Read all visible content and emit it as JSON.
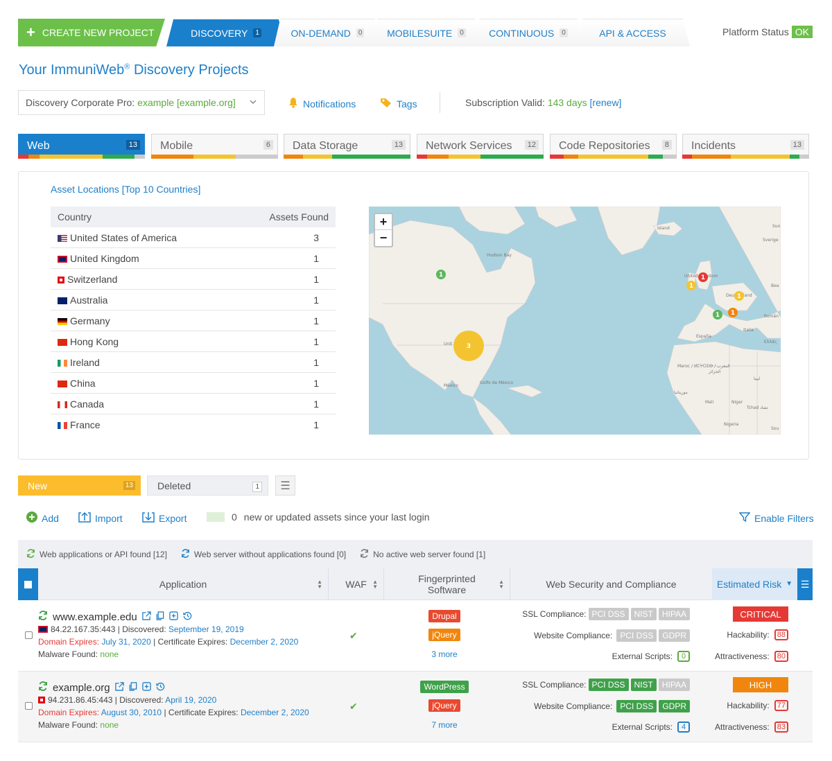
{
  "topnav": {
    "create_label": "CREATE NEW PROJECT",
    "tabs": [
      {
        "label": "DISCOVERY",
        "count": "1"
      },
      {
        "label": "ON-DEMAND",
        "count": "0"
      },
      {
        "label": "MOBILESUITE",
        "count": "0"
      },
      {
        "label": "CONTINUOUS",
        "count": "0"
      },
      {
        "label": "API & ACCESS",
        "count": ""
      }
    ],
    "platform_status_label": "Platform Status",
    "platform_status_value": "OK"
  },
  "page": {
    "title": "Your ImmuniWeb",
    "title_reg": "®",
    "title_suffix": " Discovery Projects"
  },
  "project": {
    "plan_label": "Discovery Corporate Pro:",
    "name": "example [example.org]",
    "notifications_label": "Notifications",
    "tags_label": "Tags",
    "subscription_label": "Subscription Valid:",
    "subscription_days": "143 days",
    "renew_label": "[renew]"
  },
  "asset_tabs": [
    {
      "label": "Web",
      "count": "13"
    },
    {
      "label": "Mobile",
      "count": "6"
    },
    {
      "label": "Data Storage",
      "count": "13"
    },
    {
      "label": "Network Services",
      "count": "12"
    },
    {
      "label": "Code Repositories",
      "count": "8"
    },
    {
      "label": "Incidents",
      "count": "13"
    }
  ],
  "locations": {
    "title": "Asset Locations [Top 10 Countries]",
    "col_country": "Country",
    "col_assets": "Assets Found",
    "rows": [
      {
        "country": "United States of America",
        "count": "3"
      },
      {
        "country": "United Kingdom",
        "count": "1"
      },
      {
        "country": "Switzerland",
        "count": "1"
      },
      {
        "country": "Australia",
        "count": "1"
      },
      {
        "country": "Germany",
        "count": "1"
      },
      {
        "country": "Hong Kong",
        "count": "1"
      },
      {
        "country": "Ireland",
        "count": "1"
      },
      {
        "country": "China",
        "count": "1"
      },
      {
        "country": "Canada",
        "count": "1"
      },
      {
        "country": "France",
        "count": "1"
      }
    ]
  },
  "map": {
    "zoom_in": "+",
    "zoom_out": "−",
    "labels": [
      "Ísland",
      "Sverige",
      "Hudson Bay",
      "United Kingdom",
      "Deutschland",
      "España",
      "Italia",
      "Ελλάς",
      "Român",
      "Maroc / ⵍⵎⵖⵔⵉⴱ / المغرب",
      "الجزائر",
      "ليبيا",
      "موريتانيا",
      "Mali",
      "Niger",
      "Tchad تشاد",
      "Nigeria",
      "México",
      "Golfo de México",
      "Unit",
      "Sou",
      "Bea",
      "Suo"
    ],
    "clusters": [
      {
        "label": "3",
        "color": "#f4c430"
      },
      {
        "label": "1",
        "color": "#5cb85c"
      },
      {
        "label": "1",
        "color": "#e53935"
      },
      {
        "label": "1",
        "color": "#f4c430"
      },
      {
        "label": "1",
        "color": "#f4c430"
      },
      {
        "label": "1",
        "color": "#5cb85c"
      },
      {
        "label": "1",
        "color": "#f0860d"
      }
    ]
  },
  "status_tabs": [
    {
      "label": "New",
      "count": "13"
    },
    {
      "label": "Deleted",
      "count": "1"
    }
  ],
  "actions": {
    "add": "Add",
    "import": "Import",
    "export": "Export",
    "new_count": "0",
    "new_text": "new or updated assets since your last login",
    "filters": "Enable Filters"
  },
  "found": {
    "apps": "Web applications or API found [12]",
    "noapps": "Web server without applications found [0]",
    "noserver": "No active web server found [1]"
  },
  "table_headers": {
    "application": "Application",
    "waf": "WAF",
    "fingerprinted": "Fingerprinted Software",
    "compliance": "Web Security and Compliance",
    "risk": "Estimated Risk"
  },
  "rows": [
    {
      "host": "www.example.edu",
      "ip": "84.22.167.35:443",
      "discovered_label": "Discovered:",
      "discovered": "September 19, 2019",
      "domain_label": "Domain Expires:",
      "domain": "July 31, 2020",
      "cert_label": "Certificate Expires:",
      "cert": "December 2, 2020",
      "malware_label": "Malware Found:",
      "malware": "none",
      "waf": "✔",
      "sw1": "Drupal",
      "sw2": "jQuery",
      "more": "3 more",
      "ssl_label": "SSL Compliance:",
      "web_label": "Website Compliance:",
      "ext_label": "External Scripts:",
      "ext_val": "0",
      "ssl": [
        "PCI DSS",
        "NIST",
        "HIPAA"
      ],
      "web": [
        "PCI DSS",
        "GDPR"
      ],
      "risk": "CRITICAL",
      "hack_label": "Hackability:",
      "hack": "88",
      "attr_label": "Attractiveness:",
      "attr": "80"
    },
    {
      "host": "example.org",
      "ip": "94.231.86.45:443",
      "discovered_label": "Discovered:",
      "discovered": "April 19, 2020",
      "domain_label": "Domain Expires:",
      "domain": "August 30, 2010",
      "cert_label": "Certificate Expires:",
      "cert": "December 2, 2020",
      "malware_label": "Malware Found:",
      "malware": "none",
      "waf": "✔",
      "sw1": "WordPress",
      "sw2": "jQuery",
      "more": "7 more",
      "ssl_label": "SSL Compliance:",
      "web_label": "Website Compliance:",
      "ext_label": "External Scripts:",
      "ext_val": "4",
      "ssl": [
        "PCI DSS",
        "NIST",
        "HIPAA"
      ],
      "web": [
        "PCI DSS",
        "GDPR"
      ],
      "risk": "HIGH",
      "hack_label": "Hackability:",
      "hack": "77",
      "attr_label": "Attractiveness:",
      "attr": "83"
    }
  ],
  "colors": {
    "brand_blue": "#1a80cc",
    "green": "#6cc04a",
    "critical": "#e53935",
    "high": "#f0860d",
    "new_tab": "#fbbd2c"
  }
}
